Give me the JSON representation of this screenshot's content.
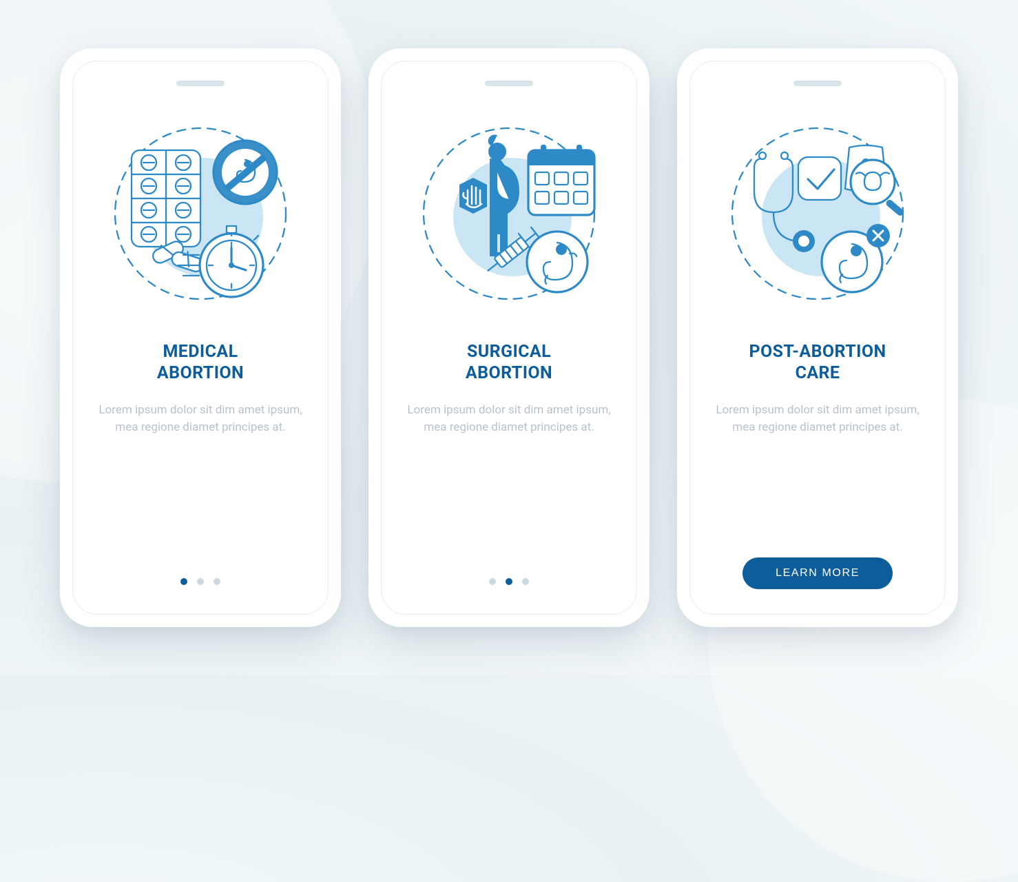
{
  "screens": [
    {
      "title": "MEDICAL\nABORTION",
      "desc": "Lorem ipsum dolor sit dim amet ipsum, mea regione diamet principes at.",
      "icon": "medical-abortion-icon",
      "pager": {
        "total": 3,
        "active": 0
      },
      "cta": null
    },
    {
      "title": "SURGICAL\nABORTION",
      "desc": "Lorem ipsum dolor sit dim amet ipsum, mea regione diamet principes at.",
      "icon": "surgical-abortion-icon",
      "pager": {
        "total": 3,
        "active": 1
      },
      "cta": null
    },
    {
      "title": "POST-ABORTION\nCARE",
      "desc": "Lorem ipsum dolor sit dim amet ipsum, mea regione diamet principes at.",
      "icon": "post-abortion-care-icon",
      "pager": null,
      "cta": "LEARN MORE"
    }
  ],
  "colors": {
    "primary": "#0d5d9a",
    "stroke": "#2e8ac6",
    "light": "#9fd2ec"
  }
}
